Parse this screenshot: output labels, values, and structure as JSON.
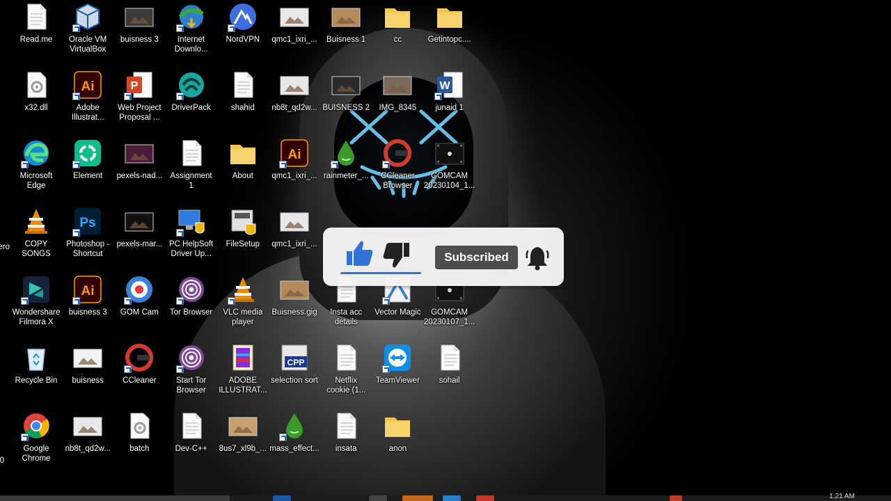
{
  "desktop": {
    "icons": [
      {
        "label": "Read.me",
        "icon": "document-icon",
        "color": "#ffffff"
      },
      {
        "label": "Oracle VM\nVirtualBox",
        "icon": "virtualbox-icon",
        "color": "#1b5aa8"
      },
      {
        "label": "buisness 3",
        "icon": "image-thumb-icon",
        "color": "#3a3a3a"
      },
      {
        "label": "Internet\nDownlo...",
        "icon": "idm-icon",
        "color": "#3ea63e"
      },
      {
        "label": "NordVPN",
        "icon": "nordvpn-icon",
        "color": "#3e6fe0"
      },
      {
        "label": "qmc1_ixri_...",
        "icon": "image-thumb-icon",
        "color": "#e8e8e8"
      },
      {
        "label": "Buisness 1",
        "icon": "image-thumb-icon",
        "color": "#b58a5a"
      },
      {
        "label": "cc",
        "icon": "folder-icon",
        "color": "#f3c74a"
      },
      {
        "label": "Getintopc....",
        "icon": "folder-icon",
        "color": "#f3c74a"
      },
      {
        "label": "x32.dll",
        "icon": "gear-file-icon",
        "color": "#ffffff"
      },
      {
        "label": "Adobe\nIllustrat...",
        "icon": "illustrator-icon",
        "color": "#ff9a00"
      },
      {
        "label": "Web Project\nProposal ...",
        "icon": "powerpoint-icon",
        "color": "#d24726"
      },
      {
        "label": "DriverPack",
        "icon": "driverpack-icon",
        "color": "#1aa6a0"
      },
      {
        "label": "shahid",
        "icon": "document-icon",
        "color": "#ffffff"
      },
      {
        "label": "nb8t_qd2w...",
        "icon": "image-thumb-icon",
        "color": "#e8e8e8"
      },
      {
        "label": "BUISNESS 2",
        "icon": "image-thumb-icon",
        "color": "#2a2a2a"
      },
      {
        "label": "IMG_8345",
        "icon": "image-thumb-icon",
        "color": "#7a6a5a"
      },
      {
        "label": "junaid 1",
        "icon": "word-icon",
        "color": "#2b579a"
      },
      {
        "label": "Microsoft\nEdge",
        "icon": "edge-icon",
        "color": "#0f8fd6"
      },
      {
        "label": "Element",
        "icon": "element-icon",
        "color": "#0dbd8b"
      },
      {
        "label": "pexels-nad...",
        "icon": "image-thumb-icon",
        "color": "#4a1b3a"
      },
      {
        "label": "Assignment\n1",
        "icon": "document-icon",
        "color": "#ffffff"
      },
      {
        "label": "About",
        "icon": "folder-icon",
        "color": "#f3c74a"
      },
      {
        "label": "qmc1_ixri_...",
        "icon": "illustrator-icon",
        "color": "#ff9a00"
      },
      {
        "label": "rainmeter_...",
        "icon": "rainmeter-icon",
        "color": "#3a9b2a"
      },
      {
        "label": "CCleaner\nBrowser",
        "icon": "ccleaner-browser-icon",
        "color": "#d6392b"
      },
      {
        "label": "GOMCAM\n20230104_1...",
        "icon": "video-thumb-icon",
        "color": "#1a1a1a"
      },
      {
        "label": "COPY\nSONGS",
        "icon": "vlc-file-icon",
        "color": "#f08a00"
      },
      {
        "label": "Photoshop -\nShortcut",
        "icon": "photoshop-icon",
        "color": "#31a8ff"
      },
      {
        "label": "pexels-mar...",
        "icon": "image-thumb-icon",
        "color": "#111111"
      },
      {
        "label": "PC HelpSoft\nDriver Up...",
        "icon": "pc-helpsoft-icon",
        "color": "#2f7de1"
      },
      {
        "label": "FileSetup",
        "icon": "setup-icon",
        "color": "#cfcfcf"
      },
      {
        "label": "qmc1_ixri_...",
        "icon": "image-thumb-icon",
        "color": "#e8e8e8"
      },
      {
        "label": "Wondershare\nFilmora X",
        "icon": "filmora-icon",
        "color": "#2ec4b6"
      },
      {
        "label": "buisness 3",
        "icon": "illustrator-icon",
        "color": "#ff9a00"
      },
      {
        "label": "GOM Cam",
        "icon": "gomcam-icon",
        "color": "#ffffff"
      },
      {
        "label": "Tor Browser",
        "icon": "tor-icon",
        "color": "#7e4798"
      },
      {
        "label": "VLC media\nplayer",
        "icon": "vlc-icon",
        "color": "#f08a00"
      },
      {
        "label": "Buisness.gig",
        "icon": "image-thumb-icon",
        "color": "#b58a5a"
      },
      {
        "label": "Insta acc\ndetails",
        "icon": "document-icon",
        "color": "#ffffff"
      },
      {
        "label": "Vector Magic",
        "icon": "vector-magic-icon",
        "color": "#3a7fd0"
      },
      {
        "label": "GOMCAM\n20230107_1...",
        "icon": "video-thumb-icon",
        "color": "#1a1a1a"
      },
      {
        "label": "Recycle Bin",
        "icon": "recycle-bin-icon",
        "color": "#9ac4e8"
      },
      {
        "label": "buisness",
        "icon": "image-thumb-icon",
        "color": "#f2f2f2"
      },
      {
        "label": "CCleaner",
        "icon": "ccleaner-icon",
        "color": "#d6392b"
      },
      {
        "label": "Start Tor\nBrowser",
        "icon": "tor-icon",
        "color": "#7e4798"
      },
      {
        "label": "ADOBE\nILLUSTRAT...",
        "icon": "winrar-icon",
        "color": "#8a2be2"
      },
      {
        "label": "selection sort",
        "icon": "cpp-icon",
        "color": "#1b3c8c"
      },
      {
        "label": "Netflix\ncookie (1...",
        "icon": "document-icon",
        "color": "#ffffff"
      },
      {
        "label": "TeamViewer",
        "icon": "teamviewer-icon",
        "color": "#0e8ee9"
      },
      {
        "label": "sohail",
        "icon": "document-icon",
        "color": "#ffffff"
      },
      {
        "label": "Google\nChrome",
        "icon": "chrome-icon",
        "color": "#4285f4"
      },
      {
        "label": "nb8t_qd2w...",
        "icon": "image-thumb-icon",
        "color": "#e8e8e8"
      },
      {
        "label": "batch",
        "icon": "gear-file-icon",
        "color": "#ffffff"
      },
      {
        "label": "Dev-C++",
        "icon": "document-icon",
        "color": "#ffffff"
      },
      {
        "label": "8us7_xl9b_...",
        "icon": "image-thumb-icon",
        "color": "#c8a070"
      },
      {
        "label": "mass_effect...",
        "icon": "rainmeter-icon",
        "color": "#3a9b2a"
      },
      {
        "label": "insata",
        "icon": "document-icon",
        "color": "#ffffff"
      },
      {
        "label": "anon",
        "icon": "folder-icon",
        "color": "#f3c74a"
      }
    ],
    "partial_left": [
      "ero",
      "0"
    ]
  },
  "overlay": {
    "like_icon": "thumbs-up-icon",
    "dislike_icon": "thumbs-down-icon",
    "subscribed_label": "Subscribed",
    "bell_icon": "bell-icon",
    "accent": "#2f73d6"
  },
  "taskbar": {
    "clock": "1:21 AM"
  }
}
